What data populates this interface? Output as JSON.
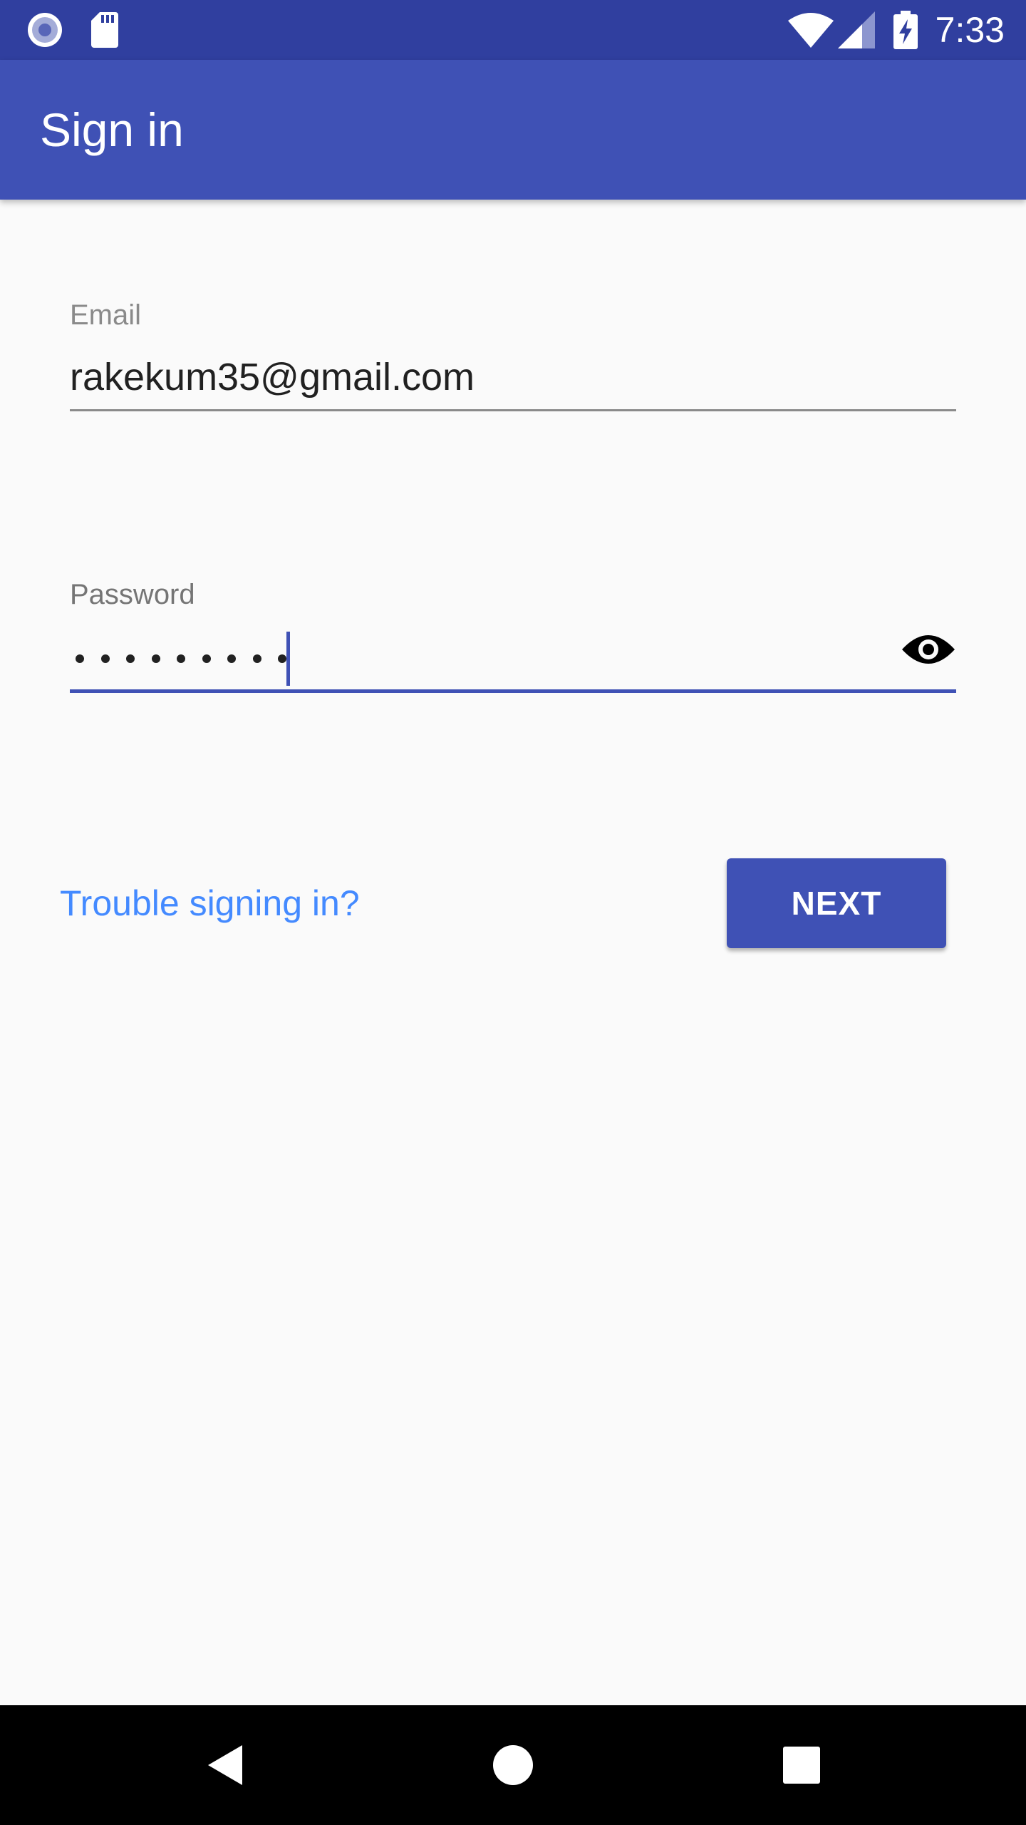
{
  "status_bar": {
    "time": "7:33",
    "icons": [
      "record-icon",
      "sd-card-icon",
      "wifi-icon",
      "cell-signal-icon",
      "battery-charging-icon"
    ]
  },
  "app_bar": {
    "title": "Sign in"
  },
  "form": {
    "email": {
      "label": "Email",
      "value": "rakekum35@gmail.com"
    },
    "password": {
      "label": "Password",
      "masked_length": 9
    }
  },
  "actions": {
    "trouble_link": "Trouble signing in?",
    "next_label": "NEXT"
  },
  "colors": {
    "status_bar": "#303f9f",
    "app_bar": "#3f51b5",
    "accent": "#3f51b5",
    "link": "#448aff",
    "background": "#fafafa"
  },
  "nav_bar": {
    "buttons": [
      "back-icon",
      "home-icon",
      "recents-icon"
    ]
  }
}
